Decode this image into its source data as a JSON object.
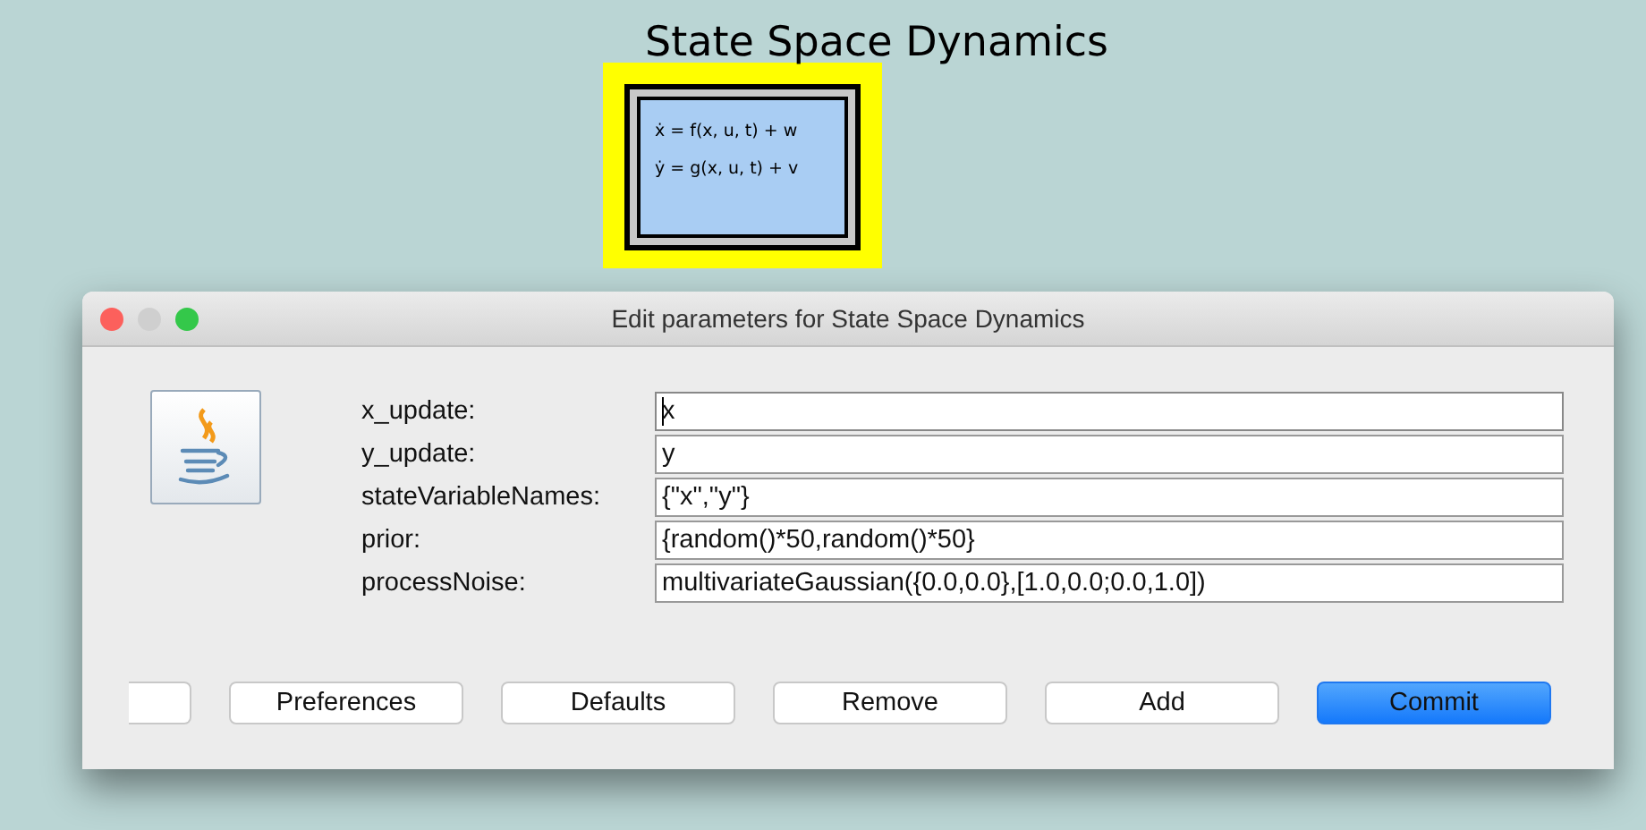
{
  "canvas": {
    "title": "State Space Dynamics",
    "block": {
      "equations": [
        "ẋ = f(x, u, t) + w",
        "ẏ = g(x, u, t) + v"
      ]
    }
  },
  "dialog": {
    "title": "Edit parameters for State Space Dynamics",
    "fields": [
      {
        "label": "x_update:",
        "value": "x",
        "focused": true
      },
      {
        "label": "y_update:",
        "value": "y",
        "focused": false
      },
      {
        "label": "stateVariableNames:",
        "value": "{\"x\",\"y\"}",
        "focused": false
      },
      {
        "label": "prior:",
        "value": "{random()*50,random()*50}",
        "focused": false
      },
      {
        "label": "processNoise:",
        "value": "multivariateGaussian({0.0,0.0},[1.0,0.0;0.0,1.0])",
        "focused": false
      }
    ],
    "buttons": [
      {
        "kind": "clipped"
      },
      {
        "kind": "plain",
        "label": "Preferences"
      },
      {
        "kind": "plain",
        "label": "Defaults"
      },
      {
        "kind": "plain",
        "label": "Remove"
      },
      {
        "kind": "plain",
        "label": "Add"
      },
      {
        "kind": "default",
        "label": "Commit"
      }
    ]
  }
}
